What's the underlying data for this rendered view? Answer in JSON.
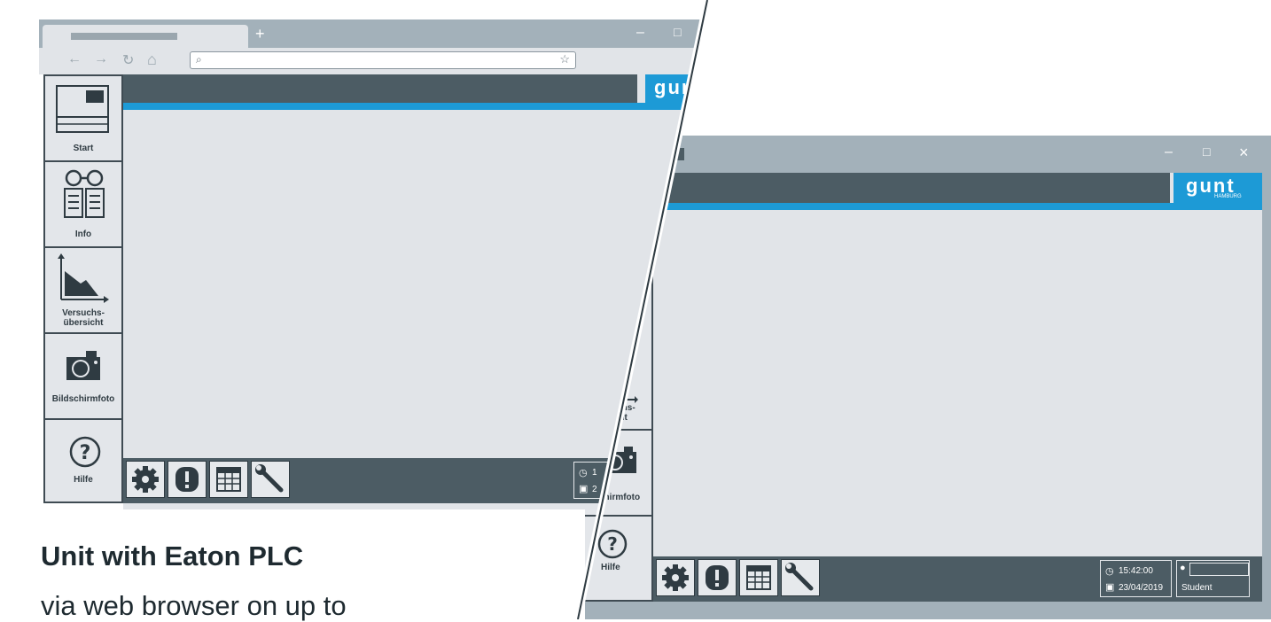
{
  "browser_window": {
    "tab_title": "",
    "new_tab_glyph": "+",
    "nav": {
      "back": "←",
      "forward": "→",
      "reload": "↻",
      "home": "⌂"
    },
    "address_value": "",
    "search_glyph": "⌕",
    "favorite_glyph": "☆",
    "window_controls": {
      "minimize": "–",
      "maximize": "□"
    }
  },
  "app_window": {
    "window_controls": {
      "minimize": "–",
      "maximize": "□",
      "close": "×"
    }
  },
  "sidebar": {
    "items": [
      {
        "label": "Start",
        "icon": "start-screen-icon"
      },
      {
        "label": "Info",
        "icon": "book-glasses-icon"
      },
      {
        "label_line1": "Versuchs-",
        "label_line2": "übersicht",
        "icon": "chart-icon"
      },
      {
        "label": "Bildschirmfoto",
        "icon": "camera-icon"
      },
      {
        "label": "Hilfe",
        "icon": "help-icon"
      }
    ]
  },
  "sidebar_partial": {
    "item3_line1": "uchs-",
    "item3_line2": "icht",
    "item4_label": "chirmfoto",
    "item5_label": "Hilfe"
  },
  "toolbar": {
    "buttons": [
      "settings-icon",
      "alert-icon",
      "table-icon",
      "wrench-icon"
    ]
  },
  "status": {
    "time": "15:42:00",
    "date": "23/04/2019",
    "user": "Student",
    "browser_time_partial": "1",
    "browser_date_partial": "2"
  },
  "logo": {
    "text": "gunt",
    "subtext": "HAMBURG"
  },
  "caption": {
    "title": "Unit with Eaton PLC",
    "subtitle": "via web browser on up to"
  },
  "colors": {
    "accent": "#1d9ad6",
    "dark": "#4c5c64",
    "frame": "#a3b1ba",
    "panel": "#e1e4e8"
  }
}
